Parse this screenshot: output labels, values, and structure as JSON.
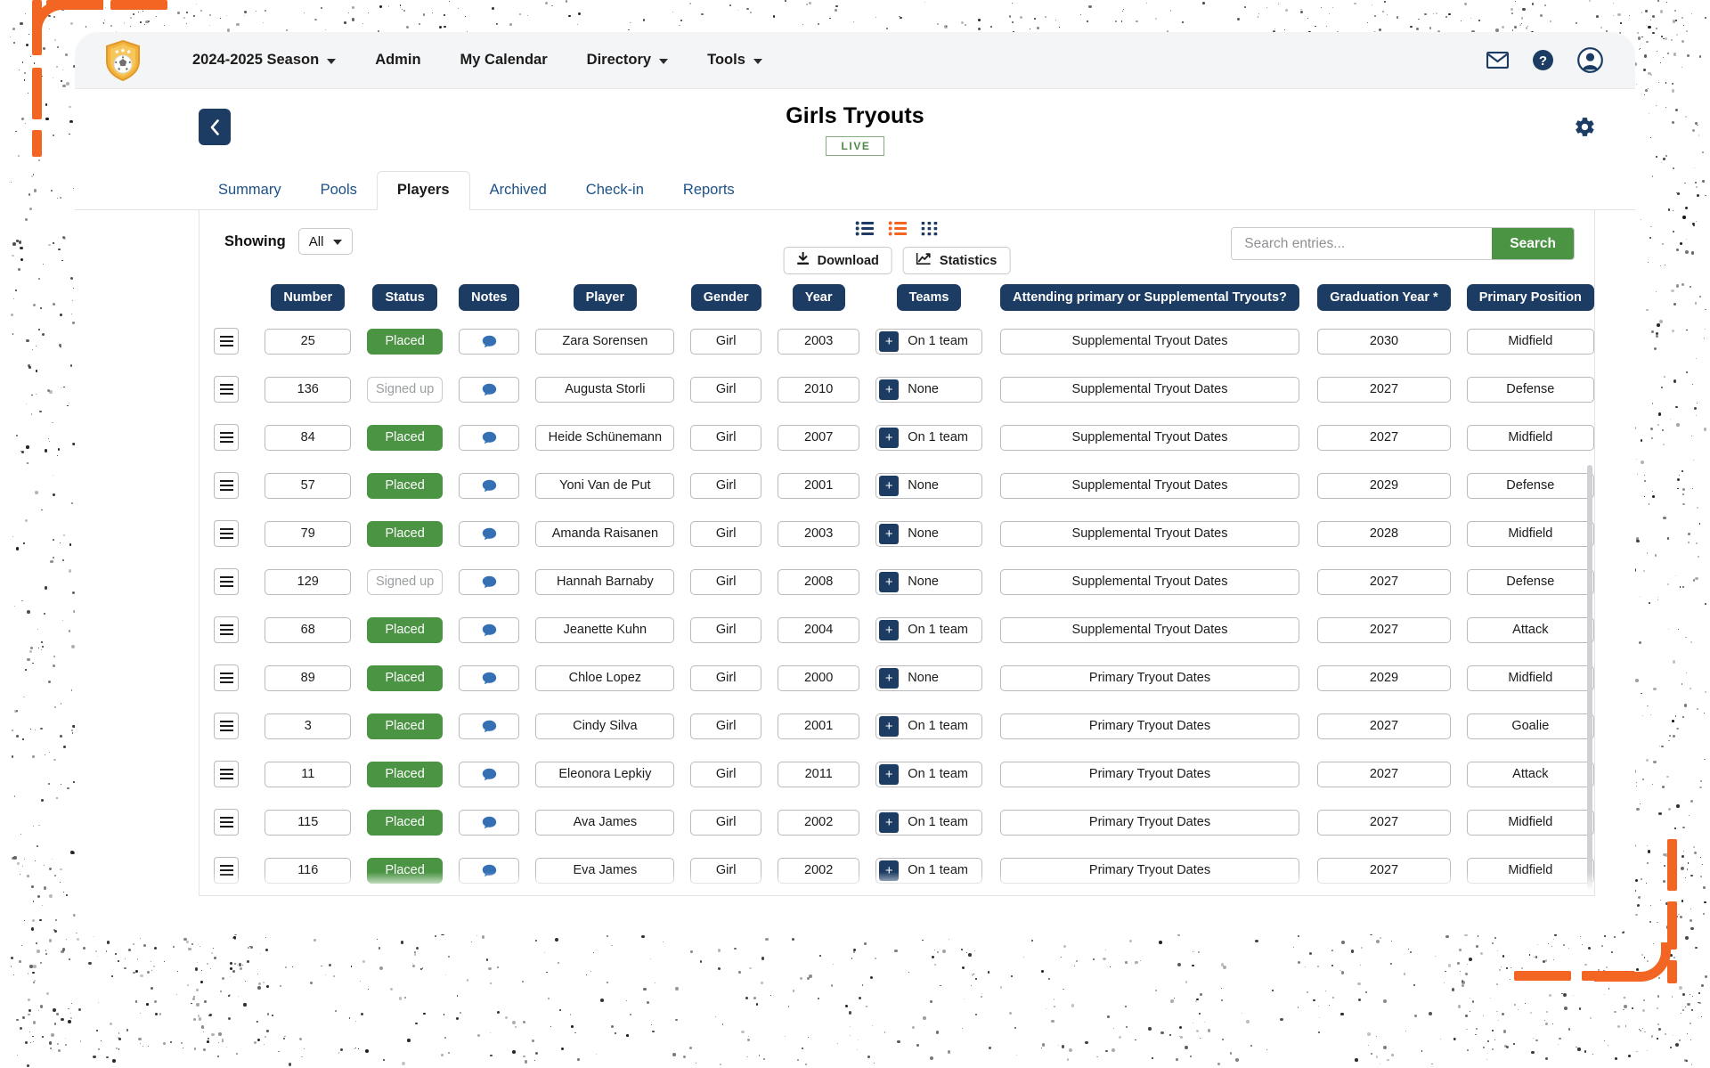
{
  "topnav": {
    "logo_icon": "soccer-shield-logo",
    "items": [
      {
        "label": "2024-2025 Season",
        "has_caret": true
      },
      {
        "label": "Admin",
        "has_caret": false
      },
      {
        "label": "My Calendar",
        "has_caret": false
      },
      {
        "label": "Directory",
        "has_caret": true
      },
      {
        "label": "Tools",
        "has_caret": true
      }
    ],
    "right_icons": [
      "envelope-icon",
      "help-icon",
      "user-avatar-icon"
    ]
  },
  "header": {
    "back_icon": "chevron-left-icon",
    "title": "Girls Tryouts",
    "status_badge": "LIVE",
    "settings_icon": "gear-icon"
  },
  "tabs": [
    {
      "label": "Summary",
      "active": false
    },
    {
      "label": "Pools",
      "active": false
    },
    {
      "label": "Players",
      "active": true
    },
    {
      "label": "Archived",
      "active": false
    },
    {
      "label": "Check-in",
      "active": false
    },
    {
      "label": "Reports",
      "active": false
    }
  ],
  "toolbar": {
    "showing_label": "Showing",
    "showing_value": "All",
    "view_modes": [
      "list-view-icon",
      "compact-list-view-icon",
      "grid-view-icon"
    ],
    "active_view": "compact-list-view-icon",
    "download_label": "Download",
    "download_icon": "download-icon",
    "statistics_label": "Statistics",
    "statistics_icon": "chart-line-icon",
    "search_placeholder": "Search entries...",
    "search_value": "",
    "search_button": "Search"
  },
  "colors": {
    "navy": "#1d3c63",
    "green": "#4a9443",
    "orange_accent": "#f26522",
    "link_blue": "#1c5289",
    "live_green": "#4f8a49"
  },
  "table": {
    "columns": [
      "Number",
      "Status",
      "Notes",
      "Player",
      "Gender",
      "Year",
      "Teams",
      "Attending primary or Supplemental Tryouts?",
      "Graduation Year *",
      "Primary Position"
    ],
    "rows": [
      {
        "number": "25",
        "status": "Placed",
        "notes_icon": "comment-icon",
        "player": "Zara Sorensen",
        "gender": "Girl",
        "year": "2003",
        "teams": "On 1 team",
        "attending": "Supplemental Tryout Dates",
        "graduation": "2030",
        "position": "Midfield"
      },
      {
        "number": "136",
        "status": "Signed up",
        "notes_icon": "comment-icon",
        "player": "Augusta Storli",
        "gender": "Girl",
        "year": "2010",
        "teams": "None",
        "attending": "Supplemental Tryout Dates",
        "graduation": "2027",
        "position": "Defense"
      },
      {
        "number": "84",
        "status": "Placed",
        "notes_icon": "comment-icon",
        "player": "Heide Schünemann",
        "gender": "Girl",
        "year": "2007",
        "teams": "On 1 team",
        "attending": "Supplemental Tryout Dates",
        "graduation": "2027",
        "position": "Midfield"
      },
      {
        "number": "57",
        "status": "Placed",
        "notes_icon": "comment-icon",
        "player": "Yoni Van de Put",
        "gender": "Girl",
        "year": "2001",
        "teams": "None",
        "attending": "Supplemental Tryout Dates",
        "graduation": "2029",
        "position": "Defense"
      },
      {
        "number": "79",
        "status": "Placed",
        "notes_icon": "comment-icon",
        "player": "Amanda Raisanen",
        "gender": "Girl",
        "year": "2003",
        "teams": "None",
        "attending": "Supplemental Tryout Dates",
        "graduation": "2028",
        "position": "Midfield"
      },
      {
        "number": "129",
        "status": "Signed up",
        "notes_icon": "comment-icon",
        "player": "Hannah Barnaby",
        "gender": "Girl",
        "year": "2008",
        "teams": "None",
        "attending": "Supplemental Tryout Dates",
        "graduation": "2027",
        "position": "Defense"
      },
      {
        "number": "68",
        "status": "Placed",
        "notes_icon": "comment-icon",
        "player": "Jeanette Kuhn",
        "gender": "Girl",
        "year": "2004",
        "teams": "On 1 team",
        "attending": "Supplemental Tryout Dates",
        "graduation": "2027",
        "position": "Attack"
      },
      {
        "number": "89",
        "status": "Placed",
        "notes_icon": "comment-icon",
        "player": "Chloe Lopez",
        "gender": "Girl",
        "year": "2000",
        "teams": "None",
        "attending": "Primary Tryout Dates",
        "graduation": "2029",
        "position": "Midfield"
      },
      {
        "number": "3",
        "status": "Placed",
        "notes_icon": "comment-icon",
        "player": "Cindy Silva",
        "gender": "Girl",
        "year": "2001",
        "teams": "On 1 team",
        "attending": "Primary Tryout Dates",
        "graduation": "2027",
        "position": "Goalie"
      },
      {
        "number": "11",
        "status": "Placed",
        "notes_icon": "comment-icon",
        "player": "Eleonora Lepkiy",
        "gender": "Girl",
        "year": "2011",
        "teams": "On 1 team",
        "attending": "Primary Tryout Dates",
        "graduation": "2027",
        "position": "Attack"
      },
      {
        "number": "115",
        "status": "Placed",
        "notes_icon": "comment-icon",
        "player": "Ava James",
        "gender": "Girl",
        "year": "2002",
        "teams": "On 1 team",
        "attending": "Primary Tryout Dates",
        "graduation": "2027",
        "position": "Midfield"
      },
      {
        "number": "116",
        "status": "Placed",
        "notes_icon": "comment-icon",
        "player": "Eva James",
        "gender": "Girl",
        "year": "2002",
        "teams": "On 1 team",
        "attending": "Primary Tryout Dates",
        "graduation": "2027",
        "position": "Midfield"
      }
    ]
  }
}
